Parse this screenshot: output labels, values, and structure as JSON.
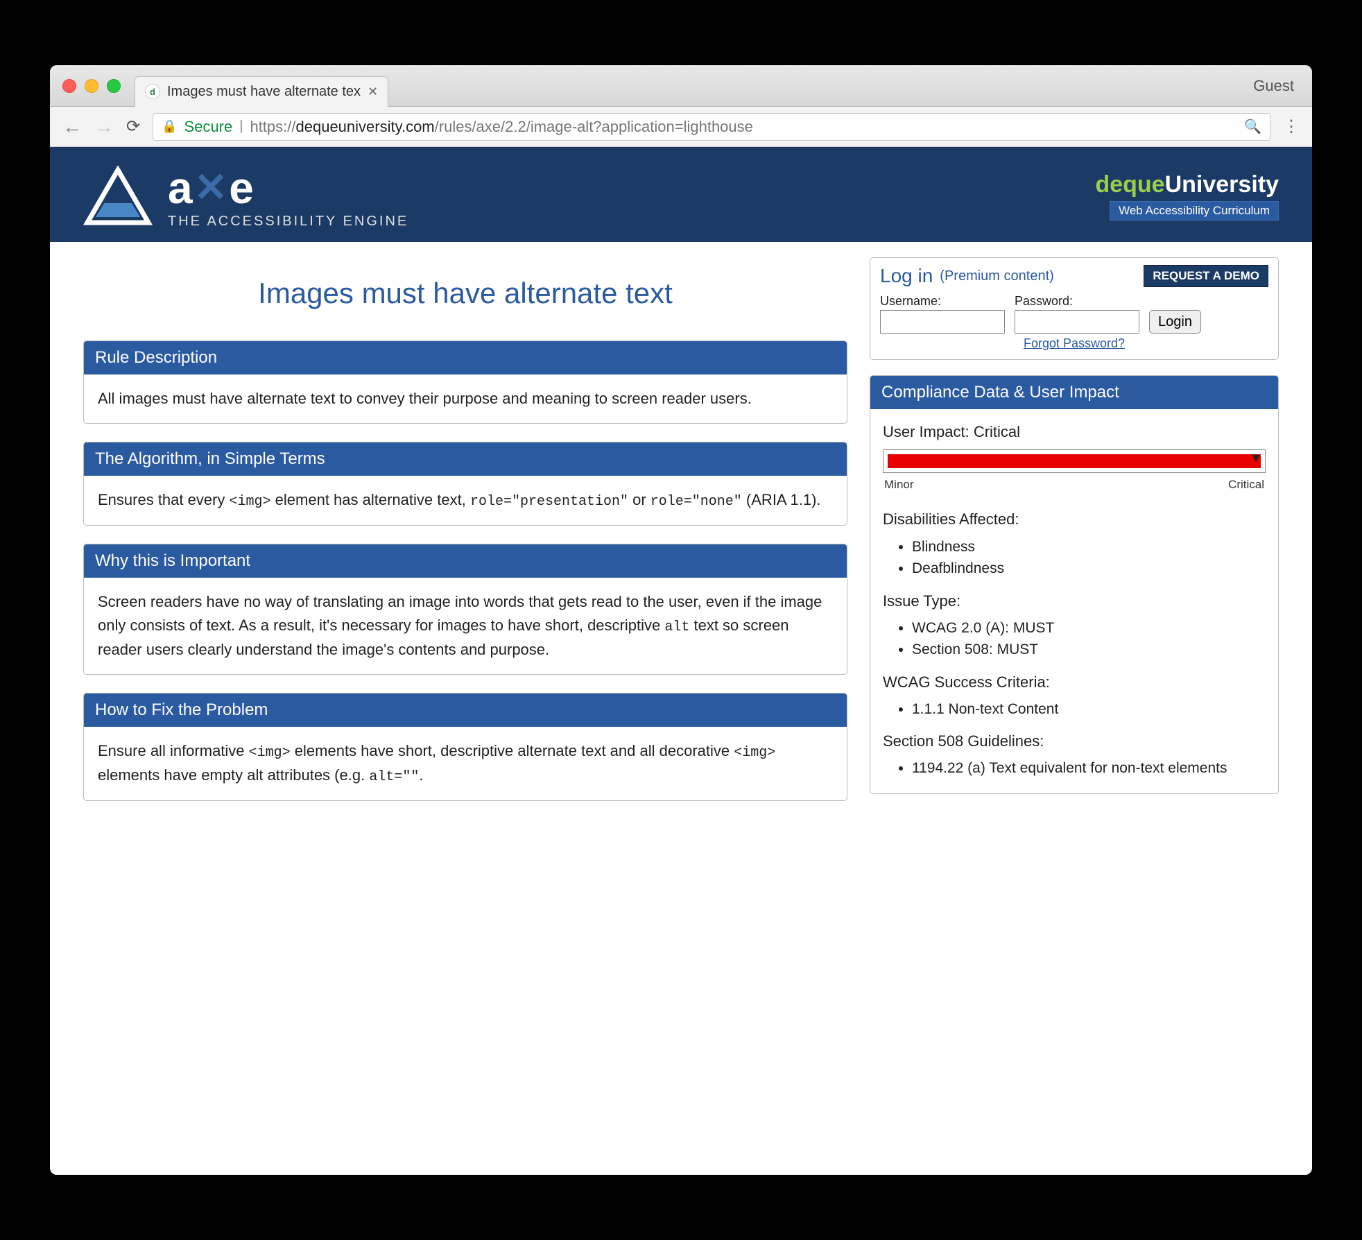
{
  "browser": {
    "tab_title": "Images must have alternate tex",
    "guest_label": "Guest",
    "secure_label": "Secure",
    "url_scheme": "https://",
    "url_host": "dequeuniversity.com",
    "url_path": "/rules/axe/2.2/image-alt?application=lighthouse"
  },
  "hero": {
    "logo_word_a": "a",
    "logo_word_x": "✕",
    "logo_word_e": "e",
    "logo_sub": "THE ACCESSIBILITY ENGINE",
    "brand_d": "deque",
    "brand_u": "University",
    "brand_badge": "Web Accessibility Curriculum"
  },
  "page_title": "Images must have alternate text",
  "login": {
    "title": "Log in",
    "subtitle": "(Premium content)",
    "demo_button": "REQUEST A DEMO",
    "username_label": "Username:",
    "password_label": "Password:",
    "login_button": "Login",
    "forgot_link": "Forgot Password?"
  },
  "panels": {
    "rule_desc": {
      "title": "Rule Description",
      "body": "All images must have alternate text to convey their purpose and meaning to screen reader users."
    },
    "algorithm": {
      "title": "The Algorithm, in Simple Terms",
      "body_pre": "Ensures that every ",
      "code1": "<img>",
      "body_mid": " element has alternative text, ",
      "code2": "role=\"presentation\"",
      "body_mid2": " or ",
      "code3": "role=\"none\"",
      "body_post": " (ARIA 1.1)."
    },
    "why": {
      "title": "Why this is Important",
      "body_pre": "Screen readers have no way of translating an image into words that gets read to the user, even if the image only consists of text. As a result, it's necessary for images to have short, descriptive ",
      "code1": "alt",
      "body_post": " text so screen reader users clearly understand the image's contents and purpose."
    },
    "fix": {
      "title": "How to Fix the Problem",
      "body_pre": "Ensure all informative ",
      "code1": "<img>",
      "body_mid": " elements have short, descriptive alternate text and all decorative ",
      "code2": "<img>",
      "body_mid2": " elements have empty alt attributes (e.g. ",
      "code3": "alt=\"\"",
      "body_post": "."
    }
  },
  "compliance": {
    "title": "Compliance Data & User Impact",
    "impact_label": "User Impact:",
    "impact_value": "Critical",
    "scale_min": "Minor",
    "scale_max": "Critical",
    "disabilities_label": "Disabilities Affected:",
    "disabilities": [
      "Blindness",
      "Deafblindness"
    ],
    "issue_type_label": "Issue Type:",
    "issue_types": [
      "WCAG 2.0 (A): MUST",
      "Section 508: MUST"
    ],
    "wcag_label": "WCAG Success Criteria:",
    "wcag": [
      "1.1.1 Non-text Content"
    ],
    "s508_label": "Section 508 Guidelines:",
    "s508": [
      "1194.22 (a) Text equivalent for non-text elements"
    ]
  }
}
